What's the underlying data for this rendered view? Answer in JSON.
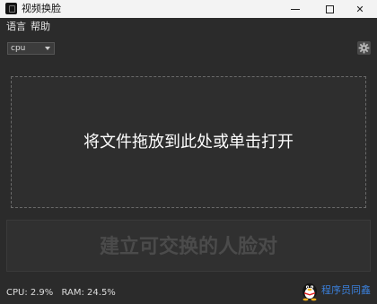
{
  "window": {
    "title": "视频换脸",
    "minimize_icon": "minimize-icon",
    "maximize_icon": "maximize-icon",
    "close_glyph": "✕"
  },
  "menu": {
    "items": [
      {
        "label": "语言"
      },
      {
        "label": "帮助"
      }
    ]
  },
  "toolbar": {
    "device_select": {
      "value": "cpu"
    },
    "settings_icon": "gear-icon"
  },
  "drop_zone": {
    "text": "将文件拖放到此处或单击打开"
  },
  "face_panel": {
    "text": "建立可交换的人脸对"
  },
  "status": {
    "cpu": "CPU: 2.9%",
    "ram": "RAM: 24.5%"
  },
  "watermark": {
    "text": "程序员同鑫",
    "icon": "penguin-icon",
    "color": "#3b7fd9"
  },
  "colors": {
    "background": "#2b2b2b",
    "titlebar": "#f3f3f3",
    "drop_border": "#6a6a6a"
  }
}
